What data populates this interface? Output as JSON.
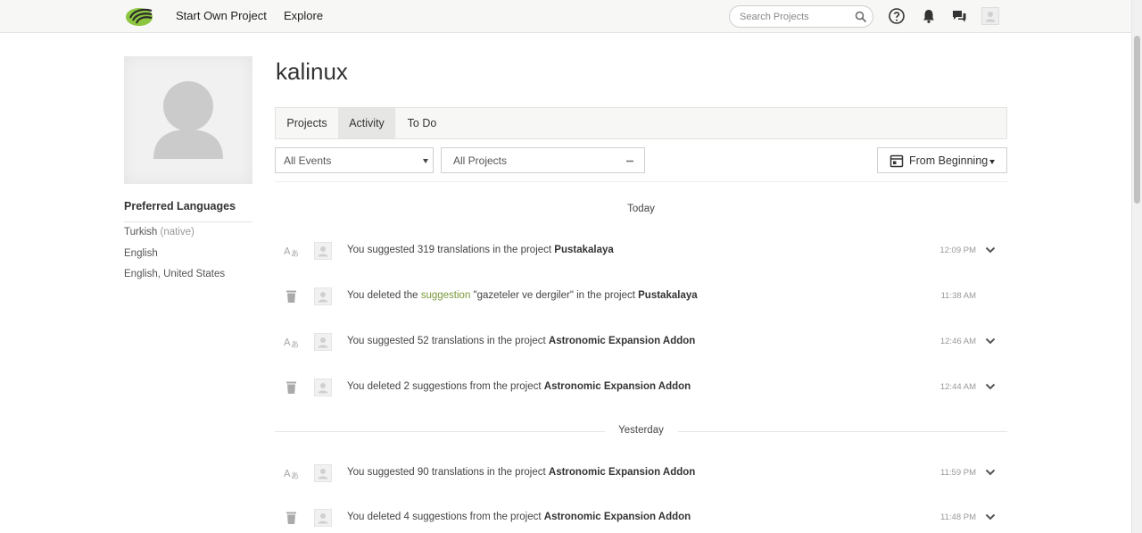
{
  "nav": {
    "start_project": "Start Own Project",
    "explore": "Explore",
    "search_placeholder": "Search Projects"
  },
  "profile": {
    "username": "kalinux",
    "preferred_languages_title": "Preferred Languages",
    "languages": [
      {
        "name": "Turkish",
        "note": "(native)"
      },
      {
        "name": "English",
        "note": ""
      },
      {
        "name": "English, United States",
        "note": ""
      }
    ]
  },
  "tabs": [
    {
      "label": "Projects",
      "active": false
    },
    {
      "label": "Activity",
      "active": true
    },
    {
      "label": "To Do",
      "active": false
    }
  ],
  "filters": {
    "events": "All Events",
    "projects": "All Projects",
    "date": "From Beginning"
  },
  "days": [
    {
      "label": "Today",
      "items": [
        {
          "type": "translate",
          "text": "You suggested 319 translations in the project ",
          "project": "Pustakalaya",
          "time": "12:09 PM",
          "expand": true
        },
        {
          "type": "delete",
          "text_before": "You deleted the ",
          "link": "suggestion",
          "text_after": " \"gazeteler ve dergiler\" in the project ",
          "project": "Pustakalaya",
          "time": "11:38 AM",
          "expand": false
        },
        {
          "type": "translate",
          "text": "You suggested 52 translations in the project ",
          "project": "Astronomic Expansion Addon",
          "time": "12:46 AM",
          "expand": true
        },
        {
          "type": "delete",
          "text": "You deleted 2 suggestions from the project ",
          "project": "Astronomic Expansion Addon",
          "time": "12:44 AM",
          "expand": true
        }
      ]
    },
    {
      "label": "Yesterday",
      "items": [
        {
          "type": "translate",
          "text": "You suggested 90 translations in the project ",
          "project": "Astronomic Expansion Addon",
          "time": "11:59 PM",
          "expand": true
        },
        {
          "type": "delete",
          "text": "You deleted 4 suggestions from the project ",
          "project": "Astronomic Expansion Addon",
          "time": "11:48 PM",
          "expand": true
        }
      ]
    }
  ],
  "colors": {
    "brand_green": "#8cc63f",
    "link_green": "#7a9a3a",
    "topbar_bg": "#f7f7f5"
  }
}
